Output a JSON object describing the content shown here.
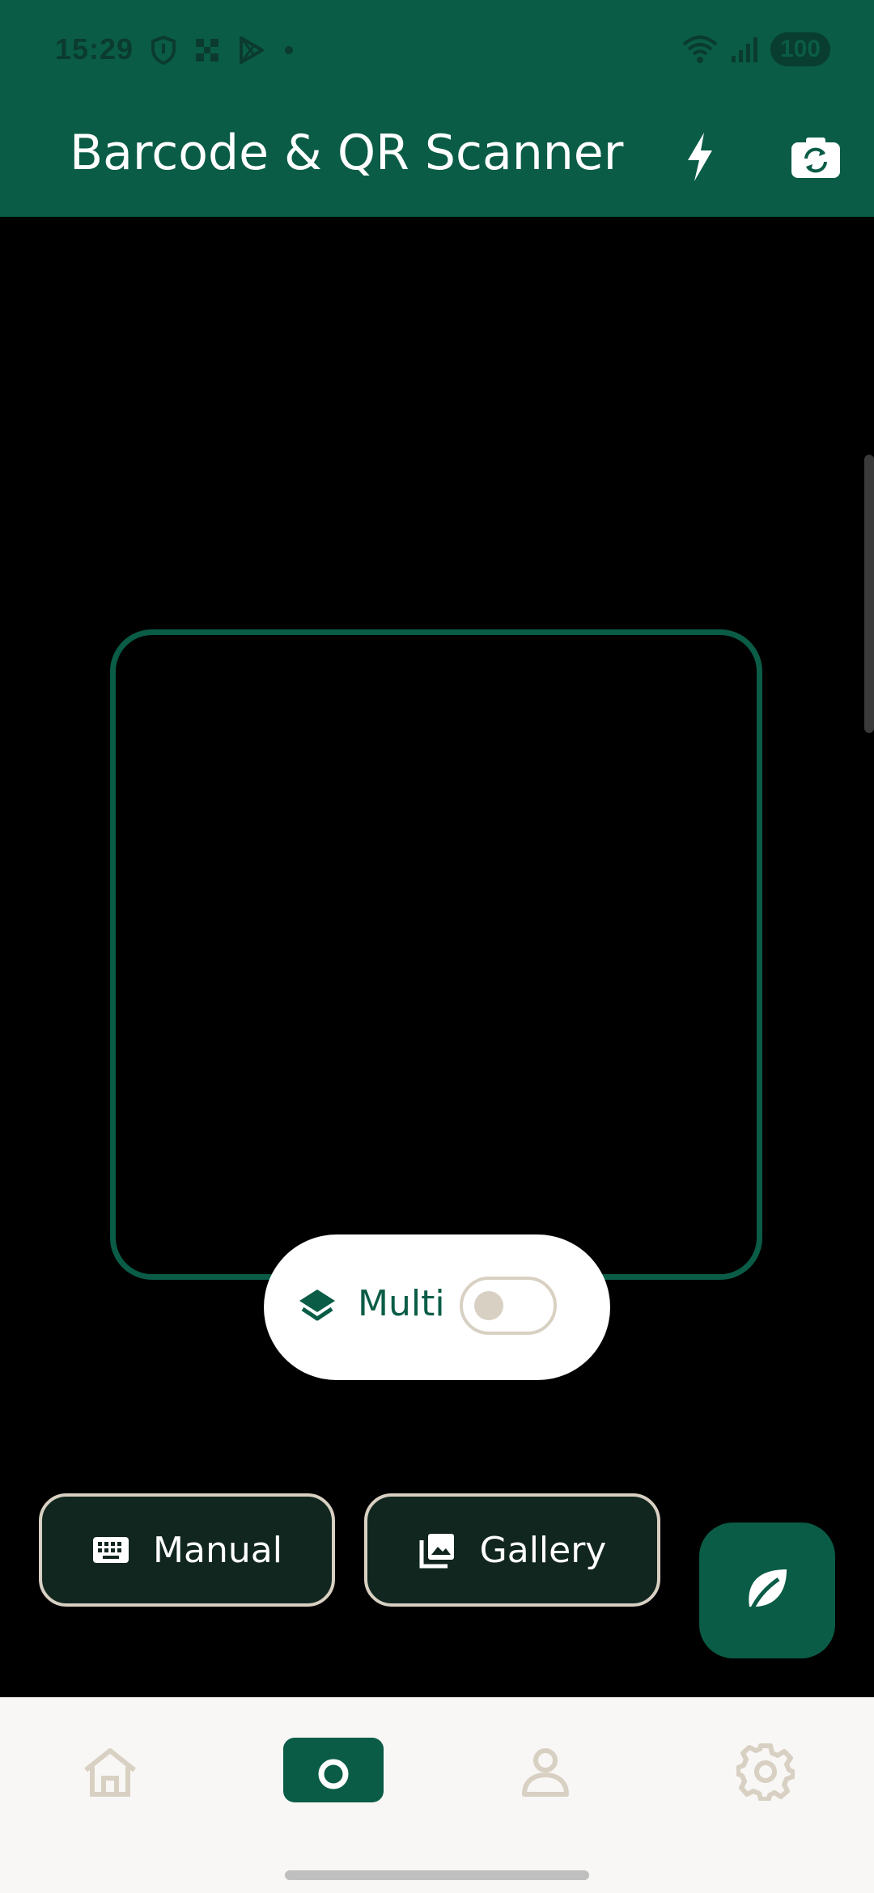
{
  "status_bar": {
    "time": "15:29",
    "battery": "100",
    "left_icons": [
      "shield-icon",
      "qr-grid-icon",
      "play-store-icon",
      "dot-icon"
    ],
    "right_icons": [
      "wifi-icon",
      "signal-icon",
      "battery-icon"
    ]
  },
  "app_bar": {
    "title": "Barcode & QR Scanner",
    "actions": [
      "flash-icon",
      "switch-camera-icon"
    ]
  },
  "scanner": {
    "multi_label": "Multi",
    "multi_enabled": false
  },
  "actions": {
    "manual_label": "Manual",
    "gallery_label": "Gallery",
    "fab_icon": "leaf-icon"
  },
  "bottom_nav": {
    "items": [
      {
        "icon": "home-icon",
        "active": false
      },
      {
        "icon": "camera-icon",
        "active": true
      },
      {
        "icon": "profile-icon",
        "active": false
      },
      {
        "icon": "settings-icon",
        "active": false
      }
    ]
  },
  "colors": {
    "primary": "#0a5c46",
    "surface": "#f8f7f5",
    "outline": "#d8d0c2",
    "button_bg": "#122620"
  }
}
